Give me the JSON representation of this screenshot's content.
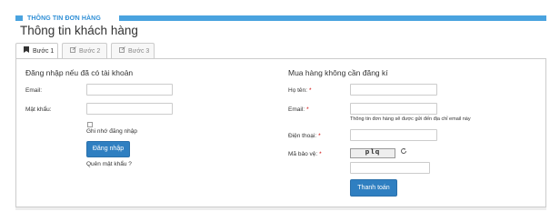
{
  "header": {
    "section_label": "THÔNG TIN ĐƠN HÀNG",
    "accent_color": "#4aa3df"
  },
  "page_title": "Thông tin khách hàng",
  "tabs": [
    {
      "label": "Bước 1",
      "icon": "bookmark-icon",
      "active": true
    },
    {
      "label": "Bước 2",
      "icon": "edit-icon",
      "active": false
    },
    {
      "label": "Bước 3",
      "icon": "edit-icon",
      "active": false
    }
  ],
  "login": {
    "heading": "Đăng nhập nếu đã có tài khoản",
    "email_label": "Email:",
    "email_value": "",
    "password_label": "Mật khẩu:",
    "password_value": "",
    "remember_label": "Ghi nhớ đăng nhập",
    "remember_checked": false,
    "login_button": "Đăng nhập",
    "forgot_link": "Quên mật khẩu ?"
  },
  "guest": {
    "heading": "Mua hàng không cần đăng kí",
    "name_label": "Họ tên:",
    "name_value": "",
    "email_label": "Email:",
    "email_value": "",
    "email_note": "Thông tin đơn hàng sẽ được gửi đến địa chỉ email này",
    "phone_label": "Điện thoại:",
    "phone_value": "",
    "captcha_label": "Mã bảo vệ:",
    "captcha_text": "plq",
    "captcha_value": "",
    "required_mark": "*",
    "checkout_button": "Thanh toán"
  },
  "colors": {
    "primary_button": "#2f7fc1",
    "required": "#cc0000"
  }
}
